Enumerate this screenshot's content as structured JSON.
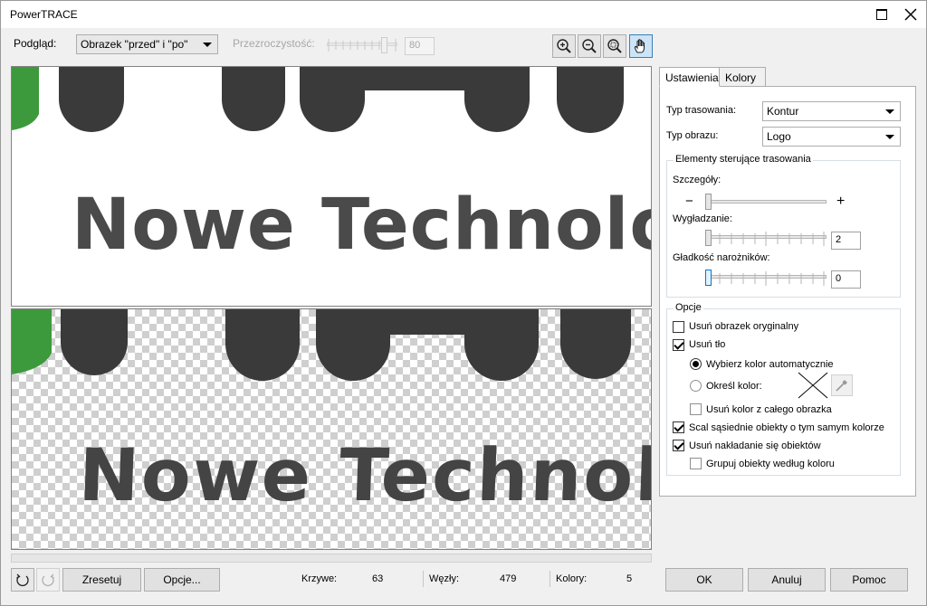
{
  "window": {
    "title": "PowerTRACE"
  },
  "toolbar": {
    "preview_label": "Podgląd:",
    "preview_value": "Obrazek \"przed\" i \"po\"",
    "transparency_label": "Przezroczystość:",
    "transparency_value": "80",
    "tools": [
      "zoom-in-icon",
      "zoom-out-icon",
      "zoom-fit-icon",
      "pan-hand-icon"
    ]
  },
  "preview": {
    "text": "Nowe Technolo"
  },
  "bottom": {
    "reset_label": "Zresetuj",
    "options_label": "Opcje...",
    "curves_label": "Krzywe:",
    "curves_value": "63",
    "nodes_label": "Węzły:",
    "nodes_value": "479",
    "colors_label": "Kolory:",
    "colors_value": "5",
    "ok_label": "OK",
    "cancel_label": "Anuluj",
    "help_label": "Pomoc"
  },
  "tabs": [
    {
      "label": "Ustawienia",
      "active": true
    },
    {
      "label": "Kolory",
      "active": false
    }
  ],
  "settings": {
    "trace_type_label": "Typ trasowania:",
    "trace_type_value": "Kontur",
    "image_type_label": "Typ obrazu:",
    "image_type_value": "Logo",
    "controls_group_title": "Elementy sterujące trasowania",
    "detail_label": "Szczegóły:",
    "detail_level": 0.0,
    "smoothing_label": "Wygładzanie:",
    "smoothing_value": "2",
    "corner_label": "Gładkość narożników:",
    "corner_value": "0",
    "options_group_title": "Opcje",
    "opt_remove_original": "Usuń obrazek oryginalny",
    "opt_remove_background": "Usuń tło",
    "opt_auto_color": "Wybierz kolor automatycznie",
    "opt_specify_color": "Określ kolor:",
    "opt_remove_color_whole": "Usuń kolor z całego obrazka",
    "opt_merge_adjacent": "Scal sąsiednie obiekty o tym samym kolorze",
    "opt_remove_overlap": "Usuń nakładanie się obiektów",
    "opt_group_by_color": "Grupuj obiekty według koloru"
  },
  "colors": {
    "logo_dark": "#3a3a3a",
    "logo_text": "#4a4a4a",
    "logo_green": "#3c9a3c",
    "accent": "#0078d7"
  }
}
